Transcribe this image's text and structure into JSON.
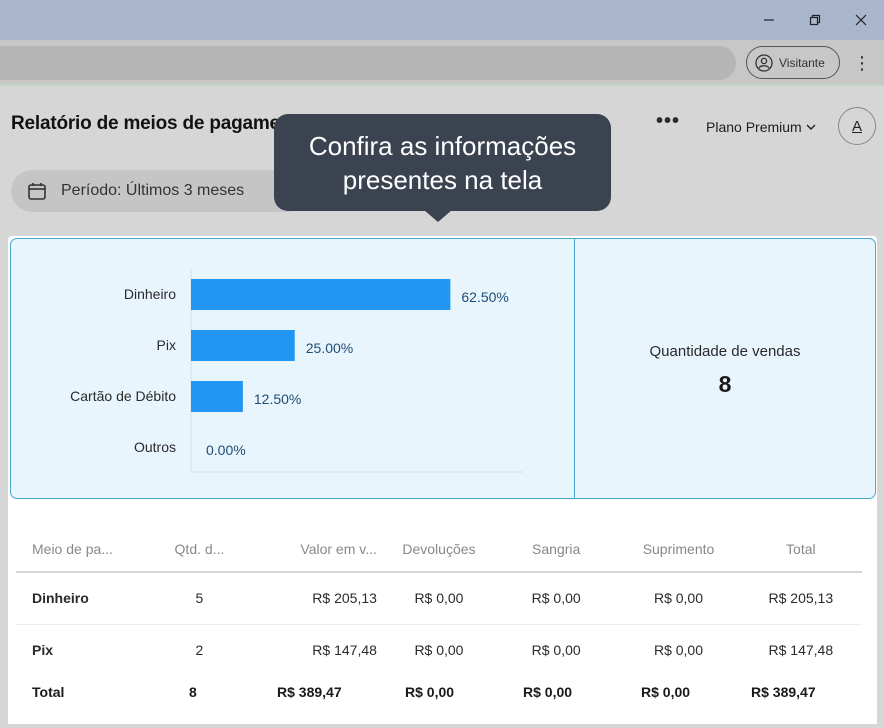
{
  "browser": {
    "profile_label": "Visitante",
    "minimize_icon": "minimize-icon",
    "restore_icon": "restore-icon",
    "close_icon": "close-icon"
  },
  "header": {
    "title": "Relatório de meios de pagamento",
    "plan_label": "Plano Premium",
    "avatar_initial": "A"
  },
  "filter": {
    "period_label": "Período: Últimos 3 meses"
  },
  "tooltip": {
    "line1": "Confira as informações",
    "line2": "presentes na tela"
  },
  "colors": {
    "bar": "#2196f3",
    "panel_bg": "#e8f5fd",
    "panel_border": "#4aa5cf",
    "tooltip_bg": "#3b4250"
  },
  "chart_data": {
    "type": "bar",
    "orientation": "horizontal",
    "categories": [
      "Dinheiro",
      "Pix",
      "Cartão de Débito",
      "Outros"
    ],
    "values": [
      62.5,
      25.0,
      12.5,
      0.0
    ],
    "value_labels": [
      "62.50%",
      "25.00%",
      "12.50%",
      "0.00%"
    ],
    "xlim": [
      0,
      100
    ],
    "grid": false
  },
  "summary": {
    "qty_label": "Quantidade de vendas",
    "qty_value": "8"
  },
  "table": {
    "headers": [
      "Meio de pa...",
      "Qtd. d...",
      "Valor em v...",
      "Devoluções",
      "Sangria",
      "Suprimento",
      "Total"
    ],
    "rows": [
      [
        "Dinheiro",
        "5",
        "R$ 205,13",
        "R$ 0,00",
        "R$ 0,00",
        "R$ 0,00",
        "R$ 205,13"
      ],
      [
        "Pix",
        "2",
        "R$ 147,48",
        "R$ 0,00",
        "R$ 0,00",
        "R$ 0,00",
        "R$ 147,48"
      ]
    ],
    "totals": [
      "Total",
      "8",
      "R$ 389,47",
      "R$ 0,00",
      "R$ 0,00",
      "R$ 0,00",
      "R$ 389,47"
    ]
  }
}
